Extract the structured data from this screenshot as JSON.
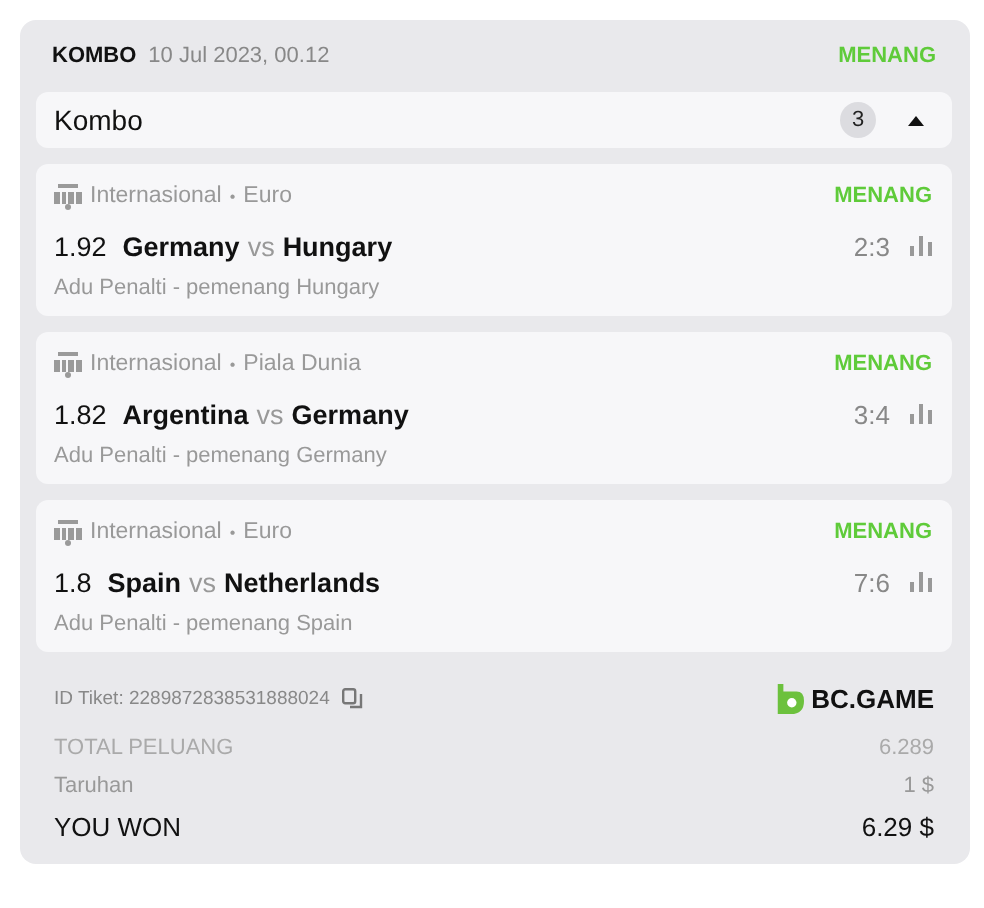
{
  "header": {
    "type": "KOMBO",
    "date": "10 Jul 2023, 00.12",
    "status": "MENANG"
  },
  "combo": {
    "label": "Kombo",
    "count": "3",
    "expanded": true
  },
  "matches": [
    {
      "league": "Internasional",
      "separator": "•",
      "tournament": "Euro",
      "status": "MENANG",
      "odds": "1.92",
      "home": "Germany",
      "vs": "vs",
      "away": "Hungary",
      "score": "2:3",
      "market": "Adu Penalti - pemenang Hungary"
    },
    {
      "league": "Internasional",
      "separator": "•",
      "tournament": "Piala Dunia",
      "status": "MENANG",
      "odds": "1.82",
      "home": "Argentina",
      "vs": "vs",
      "away": "Germany",
      "score": "3:4",
      "market": "Adu Penalti - pemenang Germany"
    },
    {
      "league": "Internasional",
      "separator": "•",
      "tournament": "Euro",
      "status": "MENANG",
      "odds": "1.8",
      "home": "Spain",
      "vs": "vs",
      "away": "Netherlands",
      "score": "7:6",
      "market": "Adu Penalti - pemenang Spain"
    }
  ],
  "ticket": {
    "id": "ID Tiket: 2289872838531888024",
    "brand": "BC.GAME"
  },
  "summary": [
    {
      "kind": "total",
      "label": "TOTAL PELUANG",
      "value": "6.289"
    },
    {
      "kind": "stake",
      "label": "Taruhan",
      "value": "1 $"
    },
    {
      "kind": "won",
      "label": "YOU WON",
      "value": "6.29 $"
    }
  ]
}
